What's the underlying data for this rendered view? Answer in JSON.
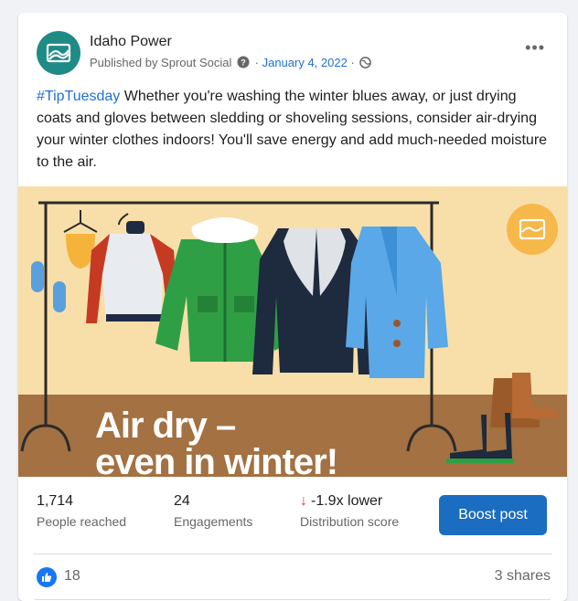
{
  "post": {
    "page_name": "Idaho Power",
    "published_by": "Published by Sprout Social",
    "separator": "·",
    "date": "January 4, 2022",
    "hashtag": "#TipTuesday",
    "body": " Whether you're washing the winter blues away, or just drying coats and gloves between sledding or shoveling sessions, consider air-drying your winter clothes indoors! You'll save energy and add much-needed moisture to the air.",
    "more_label": "•••"
  },
  "image": {
    "headline_line1": "Air dry –",
    "headline_line2": "even in winter!",
    "colors": {
      "background": "#f8dfa9",
      "floor": "#a37142",
      "logo_badge": "#f7b84a"
    }
  },
  "stats": {
    "reached": {
      "value": "1,714",
      "label": "People reached"
    },
    "engagements": {
      "value": "24",
      "label": "Engagements"
    },
    "distribution": {
      "value": "-1.9x lower",
      "label": "Distribution score",
      "arrow": "↓"
    },
    "boost_label": "Boost post"
  },
  "reactions": {
    "likes": "18",
    "shares": "3 shares"
  },
  "icons": {
    "avatar": "idaho-power-logo",
    "info": "info-icon",
    "globe": "globe-icon",
    "like": "thumbs-up-icon"
  }
}
